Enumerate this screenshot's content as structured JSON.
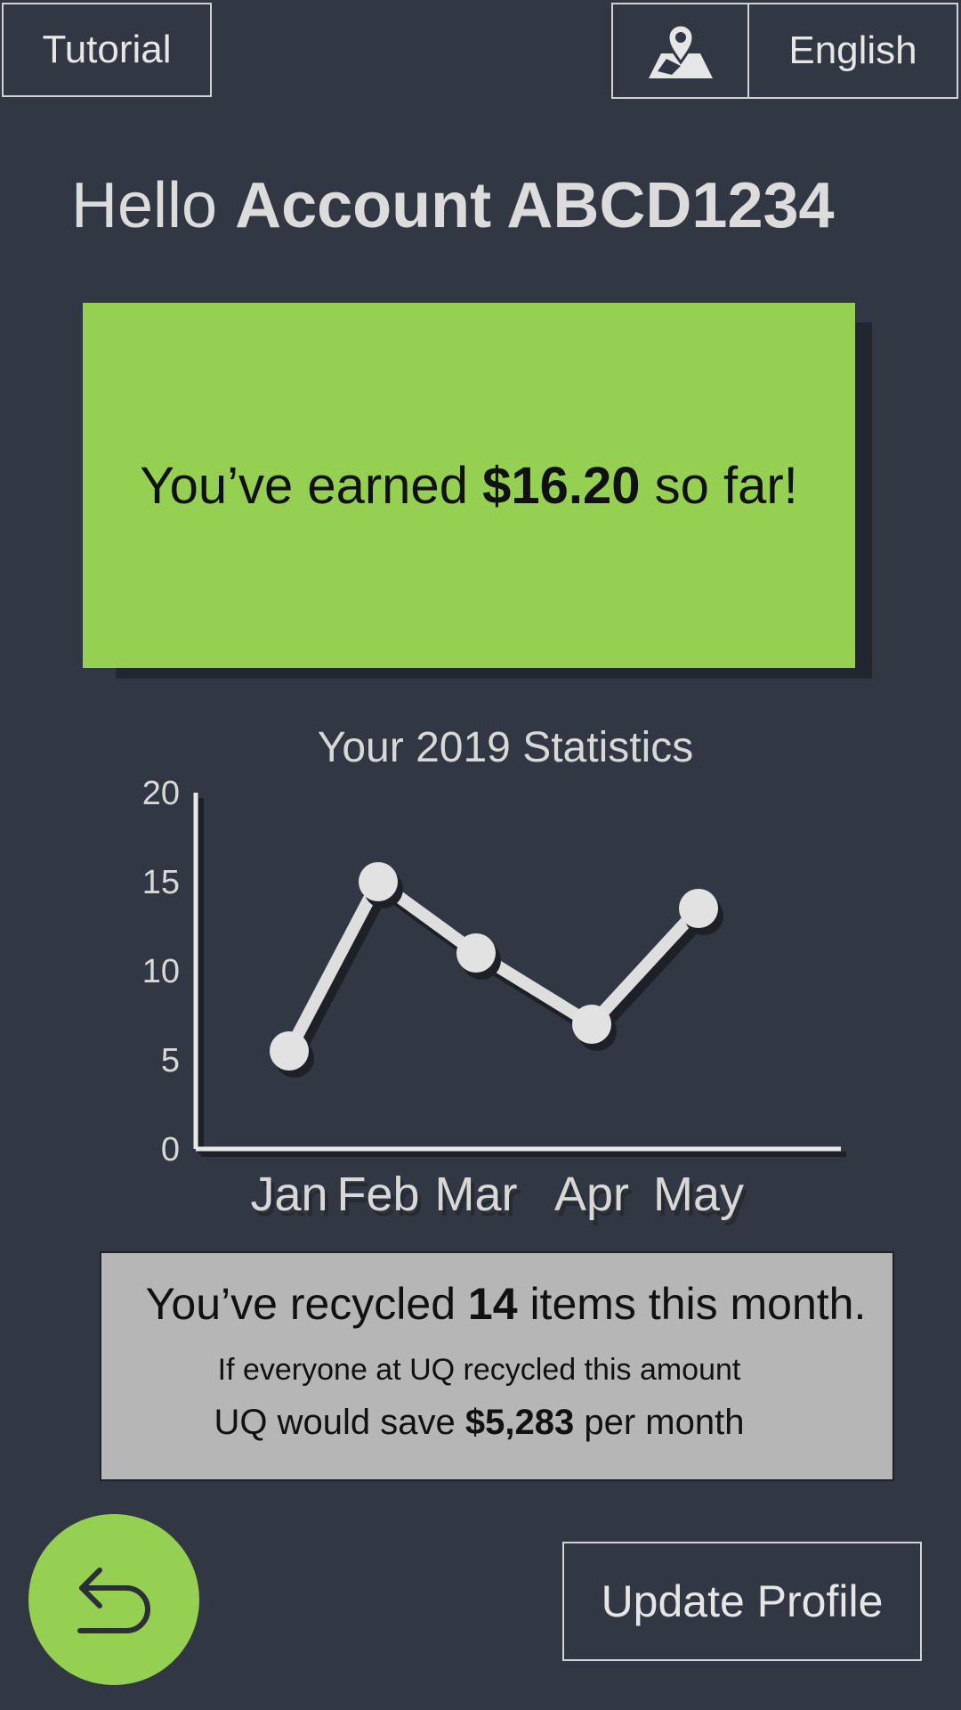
{
  "header": {
    "tutorial_label": "Tutorial",
    "language_label": "English",
    "map_icon": "map-pin-icon"
  },
  "greeting": {
    "prefix": "Hello",
    "account": "Account ABCD1234"
  },
  "earnings": {
    "before": "You’ve earned",
    "amount": "$16.20",
    "after": "so far!"
  },
  "chart_data": {
    "type": "line",
    "title": "Your 2019 Statistics",
    "categories": [
      "Jan",
      "Feb",
      "Mar",
      "Apr",
      "May"
    ],
    "values": [
      5.5,
      15,
      11,
      7,
      13.5
    ],
    "ylim": [
      0,
      20
    ],
    "yticks": [
      "0",
      "5",
      "10",
      "15",
      "20"
    ],
    "xlabel": "",
    "ylabel": "",
    "grid": false
  },
  "stats": {
    "recycled_before": "You’ve recycled",
    "recycled_count": "14",
    "recycled_after": "items this month.",
    "line2": "If everyone at UQ recycled this amount",
    "save_before": "UQ would save",
    "save_amount": "$5,283",
    "save_after": "per month"
  },
  "footer": {
    "back_icon": "undo-arrow-icon",
    "update_label": "Update Profile"
  },
  "colors": {
    "background": "#323843",
    "accent_green": "#96d052",
    "stats_card": "#b6b6b6"
  }
}
